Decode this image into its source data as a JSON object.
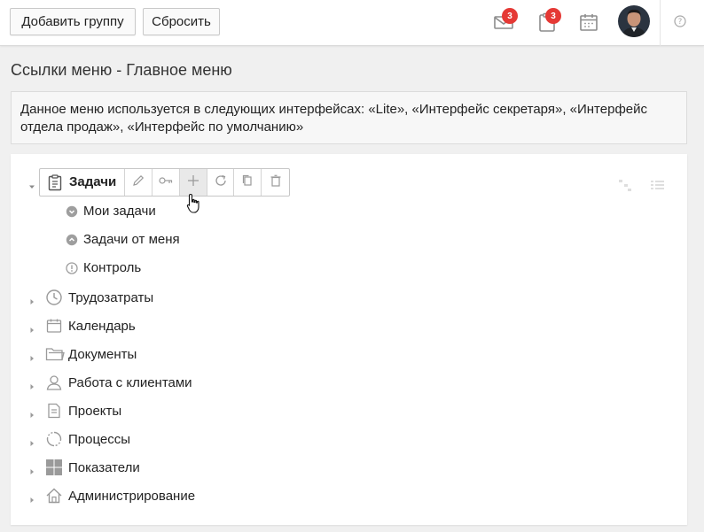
{
  "header": {
    "add_group_label": "Добавить группу",
    "reset_label": "Сбросить",
    "messages_count": "3",
    "tasks_count": "3"
  },
  "page": {
    "title": "Ссылки меню - Главное меню",
    "info_line1": "Данное меню используется в следующих интерфейсах: «Lite», «Интерфейс секретаря», «Интерфейс",
    "info_line2": "отдела продаж», «Интерфейс по умолчанию»"
  },
  "tree": {
    "selected": {
      "label": "Задачи",
      "children": [
        "Мои задачи",
        "Задачи от меня",
        "Контроль"
      ]
    },
    "items": [
      "Трудозатраты",
      "Календарь",
      "Документы",
      "Работа с клиентами",
      "Проекты",
      "Процессы",
      "Показатели",
      "Администрирование"
    ]
  },
  "colors": {
    "badge": "#e53935",
    "icon_gray": "#9e9e9e",
    "border": "#c6c6c6"
  }
}
